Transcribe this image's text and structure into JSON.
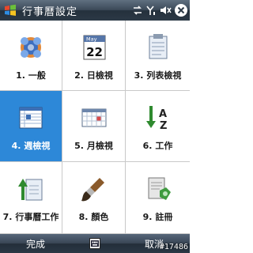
{
  "titlebar": {
    "title": "行事曆設定",
    "icons": [
      "windows-start-icon",
      "sync-icon",
      "signal-icon",
      "volume-icon",
      "close-icon"
    ]
  },
  "grid": {
    "items": [
      {
        "label": "1. 一般",
        "icon": "general-icon"
      },
      {
        "label": "2. 日檢視",
        "icon": "day-calendar-icon",
        "icon_text_top": "May",
        "icon_text_day": "22"
      },
      {
        "label": "3. 列表檢視",
        "icon": "list-clipboard-icon"
      },
      {
        "label": "4. 週檢視",
        "icon": "week-view-icon",
        "selected": true
      },
      {
        "label": "5. 月檢視",
        "icon": "month-view-icon"
      },
      {
        "label": "6. 工作",
        "icon": "sort-az-icon",
        "icon_text_a": "A",
        "icon_text_z": "Z"
      },
      {
        "label": "7. 行事曆工作",
        "icon": "upload-task-icon"
      },
      {
        "label": "8. 顏色",
        "icon": "paintbrush-icon"
      },
      {
        "label": "9. 註冊",
        "icon": "register-icon"
      }
    ]
  },
  "softbar": {
    "left": "完成",
    "right": "取消",
    "center_icon": "keyboard-icon"
  },
  "watermark": "#17486",
  "colors": {
    "selected": "#2d88d8",
    "titlebar": "#3c4a59"
  }
}
